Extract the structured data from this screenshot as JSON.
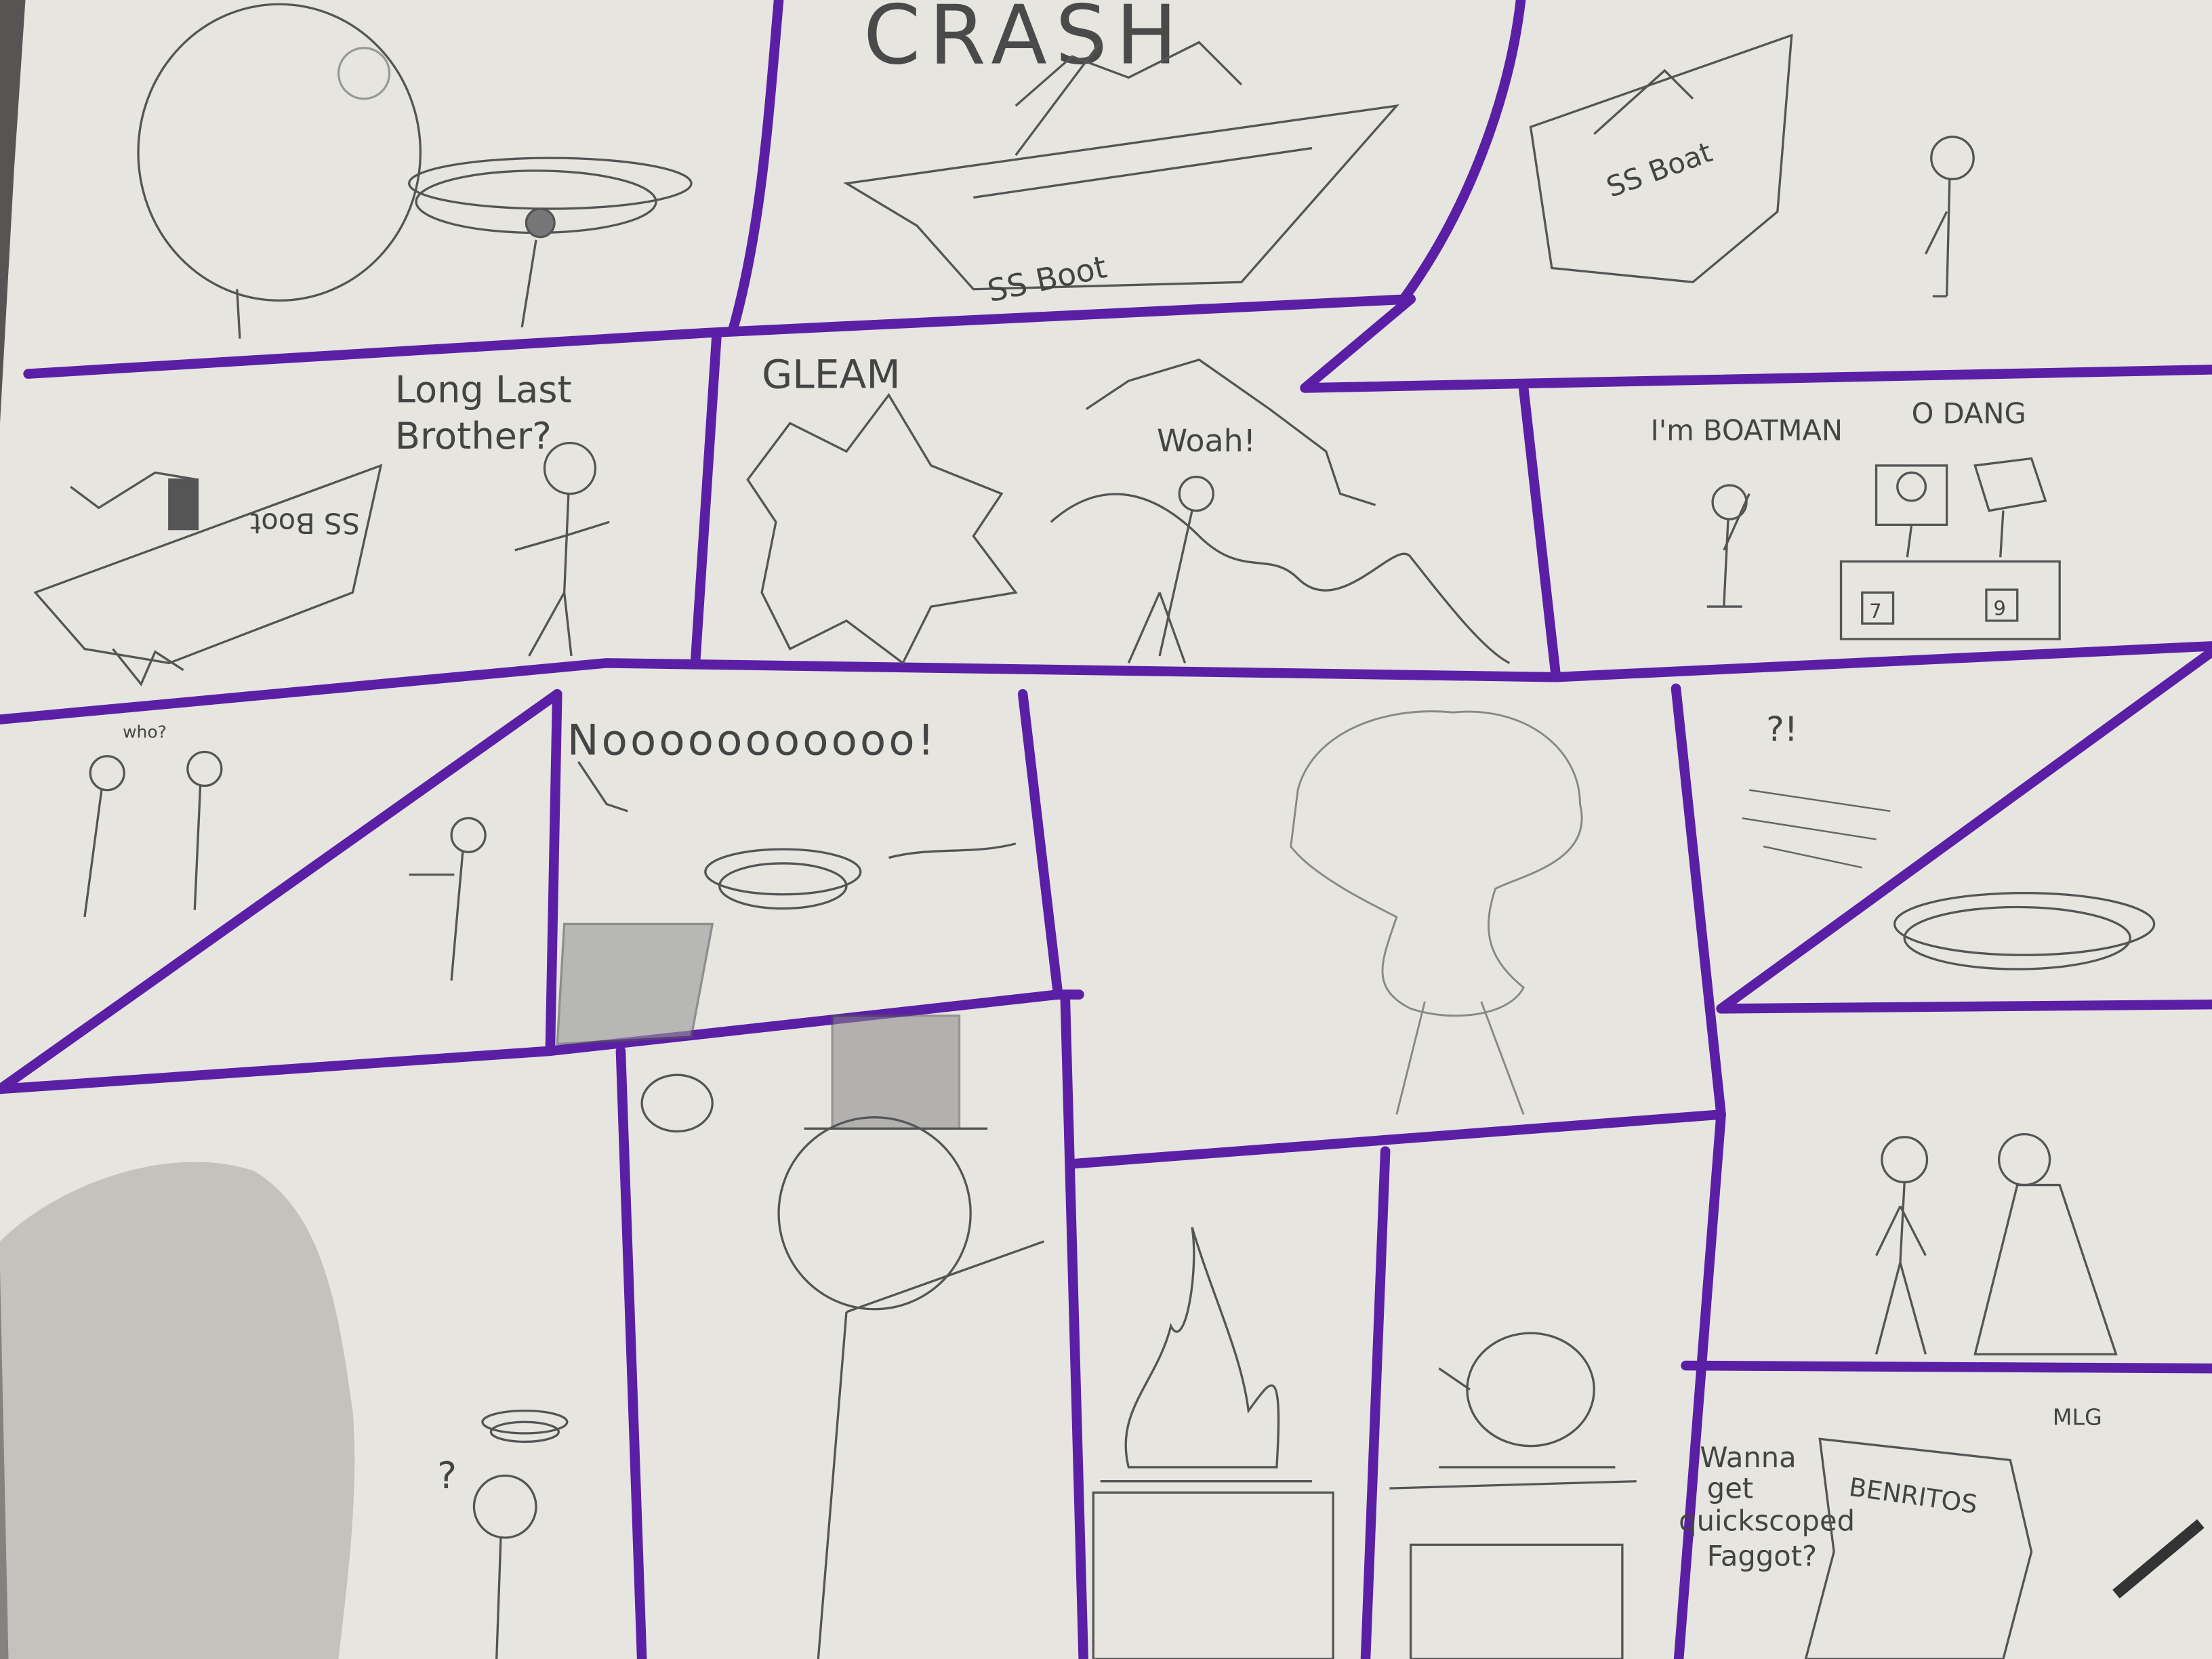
{
  "colors": {
    "paper": "#ecebe7",
    "border": "#5b1fa6",
    "pencil": "#555555",
    "background": "#2c2a2a"
  },
  "texts": {
    "crash": "CRASH",
    "ss_boot_1": "SS Boot",
    "ss_boot_2": "SS Boat",
    "ss_boot_3": "SS Boot",
    "long_last": "Long Last",
    "brother": "Brother?",
    "gleam": "GLEAM",
    "woah": "Woah!",
    "im_boatman": "I'm BOATMAN",
    "o_dang": "O DANG",
    "box_7": "7",
    "box_9": "9",
    "who": "who?",
    "nooo": "Nooooooooooo!",
    "huh": "?!",
    "question": "?",
    "wanna": "Wanna",
    "get": "get",
    "quickscoped": "quickscoped",
    "faggot": "Faggot?",
    "mlg": "MLG",
    "benritos": "BENRITOS"
  }
}
